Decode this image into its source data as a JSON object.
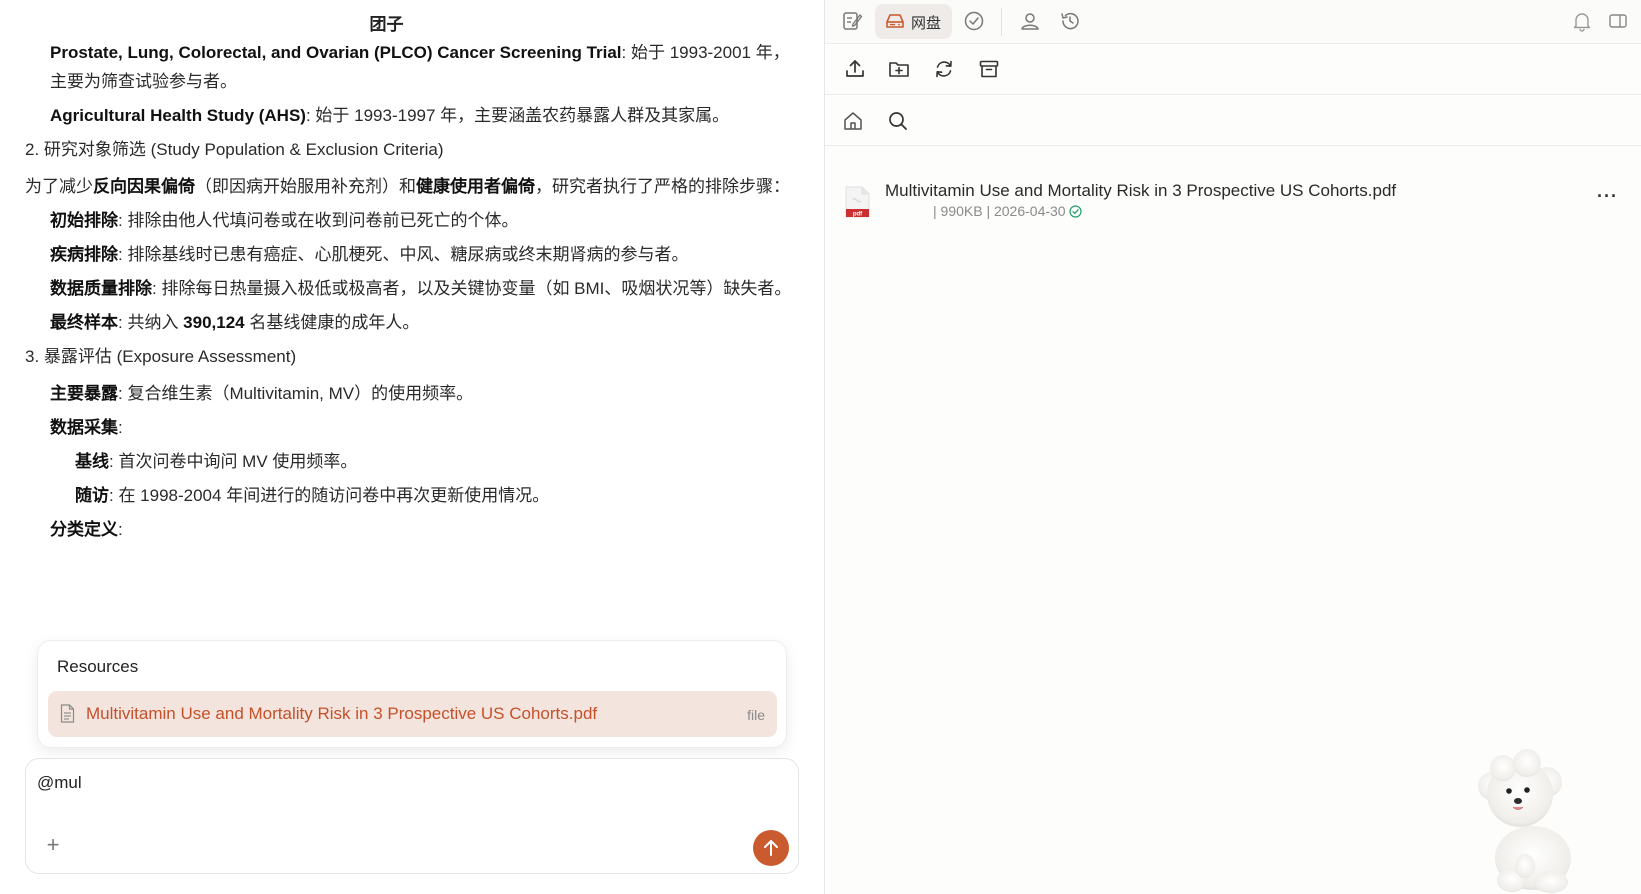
{
  "chat": {
    "title": "团子",
    "lines": {
      "l1_b": "Prostate, Lung, Colorectal, and Ovarian (PLCO) Cancer Screening Trial",
      "l1_t": ": 始于 1993-2001 年，",
      "l2": "主要为筛查试验参与者。",
      "l3_b": "Agricultural Health Study (AHS)",
      "l3_t": ": 始于 1993-1997 年，主要涵盖农药暴露人群及其家属。",
      "s2": "2. 研究对象筛选 (Study Population & Exclusion Criteria)",
      "p_a": "为了减少",
      "p_b1": "反向因果偏倚",
      "p_c": "（即因病开始服用补充剂）和",
      "p_b2": "健康使用者偏倚",
      "p_d": "，研究者执行了严格的排除步骤：",
      "e1_b": "初始排除",
      "e1_t": ": 排除由他人代填问卷或在收到问卷前已死亡的个体。",
      "e2_b": "疾病排除",
      "e2_t": ": 排除基线时已患有癌症、心肌梗死、中风、糖尿病或终末期肾病的参与者。",
      "e3_b": "数据质量排除",
      "e3_t": ": 排除每日热量摄入极低或极高者，以及关键协变量（如 BMI、吸烟状况等）缺失者。",
      "e4_b": "最终样本",
      "e4_t1": ": 共纳入 ",
      "e4_n": "390,124",
      "e4_t2": " 名基线健康的成年人。",
      "s3": "3. 暴露评估 (Exposure Assessment)",
      "x1_b": "主要暴露",
      "x1_t": ": 复合维生素（Multivitamin, MV）的使用频率。",
      "x2_b": "数据采集",
      "x2_t": ":",
      "y1_b": "基线",
      "y1_t": ": 首次问卷中询问 MV 使用频率。",
      "y2_b": "随访",
      "y2_t": ": 在 1998-2004 年间进行的随访问卷中再次更新使用情况。",
      "z1_b": "分类定义",
      "z1_t": ":"
    }
  },
  "resources": {
    "title": "Resources",
    "item_name": "Multivitamin Use and Mortality Risk in 3 Prospective US Cohorts.pdf",
    "item_type": "file"
  },
  "composer": {
    "value": "@mul",
    "plus": "+"
  },
  "right": {
    "tab_label": "网盘",
    "file": {
      "name": "Multivitamin Use and Mortality Risk in 3 Prospective US Cohorts.pdf",
      "meta": "| 990KB | 2026-04-30",
      "more": "···"
    }
  },
  "colors": {
    "accent": "#c95b2e",
    "resource_bg": "#f3e4dd",
    "resource_text": "#c4512b",
    "ok": "#22a06b"
  }
}
